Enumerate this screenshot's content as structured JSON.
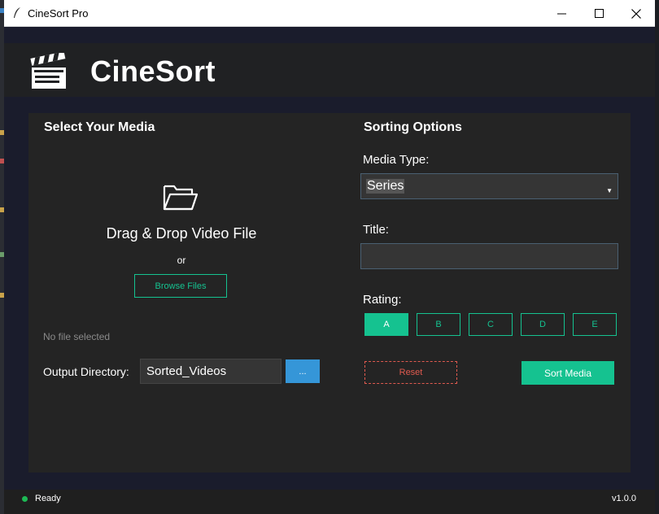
{
  "window": {
    "title": "CineSort Pro",
    "minimize_icon": "minimize-icon",
    "maximize_icon": "maximize-icon",
    "close_icon": "close-icon"
  },
  "header": {
    "brand": "CineSort",
    "logo_icon": "clapperboard-icon"
  },
  "media": {
    "heading": "Select Your Media",
    "drop_text": "Drag & Drop Video File",
    "or_text": "or",
    "browse_label": "Browse Files",
    "file_status": "No file selected",
    "output_label": "Output Directory:",
    "output_value": "Sorted_Videos",
    "output_browse_label": "..."
  },
  "options": {
    "heading": "Sorting Options",
    "media_type_label": "Media Type:",
    "media_type_value": "Series",
    "title_label": "Title:",
    "title_value": "",
    "rating_label": "Rating:",
    "ratings": [
      "A",
      "B",
      "C",
      "D",
      "E"
    ],
    "selected_rating": "A",
    "reset_label": "Reset",
    "sort_label": "Sort Media"
  },
  "status": {
    "text": "Ready",
    "version": "v1.0.0"
  },
  "colors": {
    "accent": "#15c290",
    "danger": "#e05a4f",
    "info": "#3596d8",
    "status_ok": "#1db954"
  }
}
